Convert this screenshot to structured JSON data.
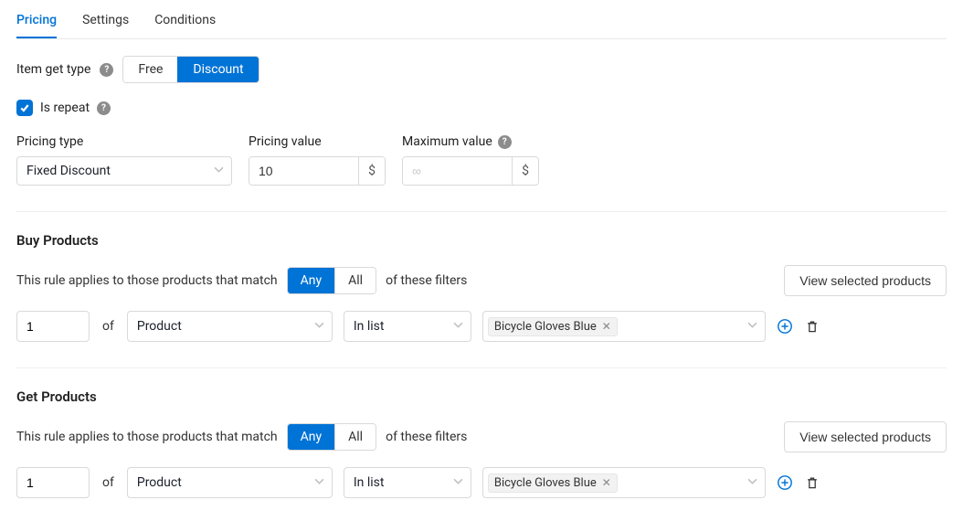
{
  "tabs": {
    "pricing": "Pricing",
    "settings": "Settings",
    "conditions": "Conditions"
  },
  "item_get_type": {
    "label": "Item get type",
    "free": "Free",
    "discount": "Discount"
  },
  "is_repeat": {
    "label": "Is repeat",
    "checked": true
  },
  "pricing_type": {
    "label": "Pricing type",
    "value": "Fixed Discount"
  },
  "pricing_value": {
    "label": "Pricing value",
    "value": "10",
    "addon": "$"
  },
  "maximum_value": {
    "label": "Maximum value",
    "placeholder": "∞",
    "addon": "$"
  },
  "match_any": "Any",
  "match_all": "All",
  "buy": {
    "title": "Buy Products",
    "rule_text_pre": "This rule applies to those products that match",
    "rule_text_post": "of these filters",
    "view_btn": "View selected products",
    "qty": "1",
    "of": "of",
    "filter_type": "Product",
    "operator": "In list",
    "tag": "Bicycle Gloves Blue"
  },
  "get": {
    "title": "Get Products",
    "rule_text_pre": "This rule applies to those products that match",
    "rule_text_post": "of these filters",
    "view_btn": "View selected products",
    "qty": "1",
    "of": "of",
    "filter_type": "Product",
    "operator": "In list",
    "tag": "Bicycle Gloves Blue"
  }
}
